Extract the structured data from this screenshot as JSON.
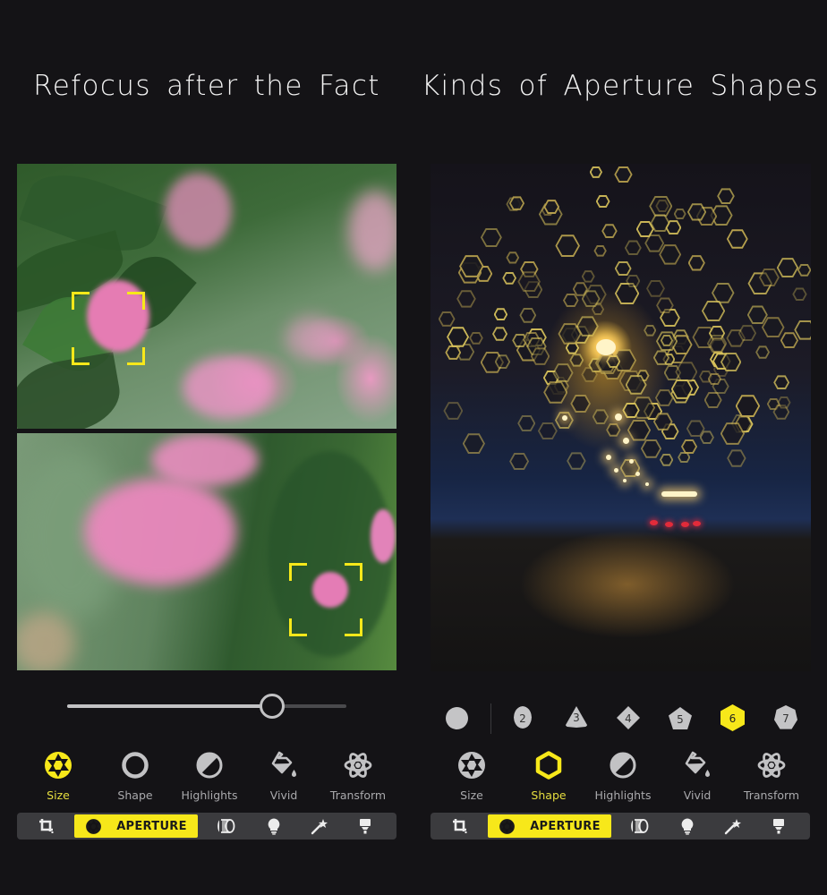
{
  "panels": [
    {
      "title": "Refocus after the Fact",
      "slider": {
        "value_fraction": 0.735
      },
      "tools": [
        {
          "label": "Size",
          "icon": "aperture-icon",
          "active": true
        },
        {
          "label": "Shape",
          "icon": "ring-icon",
          "active": false
        },
        {
          "label": "Highlights",
          "icon": "highlights-icon",
          "active": false
        },
        {
          "label": "Vivid",
          "icon": "paint-bucket-icon",
          "active": false
        },
        {
          "label": "Transform",
          "icon": "atom-icon",
          "active": false
        }
      ],
      "toolbar": {
        "items": [
          {
            "icon": "crop-icon"
          },
          {
            "icon": "aperture-icon",
            "label": "APERTURE",
            "active": true
          },
          {
            "icon": "lens-icon"
          },
          {
            "icon": "lightbulb-icon"
          },
          {
            "icon": "magic-wand-icon"
          },
          {
            "icon": "flash-icon"
          }
        ]
      }
    },
    {
      "title": "Kinds of Aperture Shapes",
      "shapes": {
        "options": [
          "",
          "2",
          "3",
          "4",
          "5",
          "6",
          "7"
        ],
        "selected": "6"
      },
      "tools": [
        {
          "label": "Size",
          "icon": "aperture-icon",
          "active": false
        },
        {
          "label": "Shape",
          "icon": "hexagon-ring-icon",
          "active": true
        },
        {
          "label": "Highlights",
          "icon": "highlights-icon",
          "active": false
        },
        {
          "label": "Vivid",
          "icon": "paint-bucket-icon",
          "active": false
        },
        {
          "label": "Transform",
          "icon": "atom-icon",
          "active": false
        }
      ],
      "toolbar": {
        "items": [
          {
            "icon": "crop-icon"
          },
          {
            "icon": "aperture-icon",
            "label": "APERTURE",
            "active": true
          },
          {
            "icon": "lens-icon"
          },
          {
            "icon": "lightbulb-icon"
          },
          {
            "icon": "magic-wand-icon"
          },
          {
            "icon": "flash-icon"
          }
        ]
      }
    }
  ],
  "colors": {
    "background": "#141316",
    "accent": "#f7e81a",
    "icon": "#c2c2c4",
    "toolbar": "#3b3b3e"
  }
}
